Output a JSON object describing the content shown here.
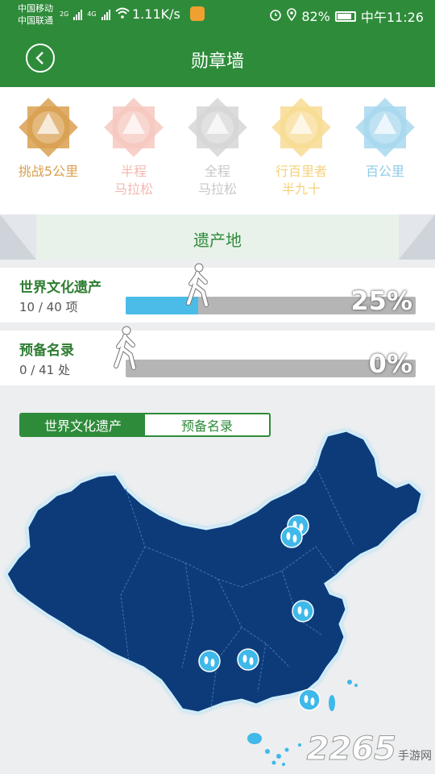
{
  "status_bar": {
    "carrier1": "中国移动",
    "carrier2": "中国联通",
    "net1": "2G",
    "net2": "4G",
    "speed": "1.11K/s",
    "battery": "82%",
    "time": "中午11:26"
  },
  "header": {
    "title": "勋章墙",
    "back_icon": "back-arrow-icon"
  },
  "badges": [
    {
      "label": "挑战5公里",
      "color": "#d9a050",
      "fill": "#d9a050",
      "state": "earned"
    },
    {
      "label": "半程\n马拉松",
      "color": "#f4b8b0",
      "fill": "#f6c8c0",
      "state": "locked"
    },
    {
      "label": "全程\n马拉松",
      "color": "#c8c8c8",
      "fill": "#d6d6d6",
      "state": "locked"
    },
    {
      "label": "行百里者\n半九十",
      "color": "#f5d27a",
      "fill": "#f8dc94",
      "state": "locked"
    },
    {
      "label": "百公里",
      "color": "#8fcbe8",
      "fill": "#a8d8ee",
      "state": "locked"
    }
  ],
  "section": {
    "title": "遗产地"
  },
  "progress": [
    {
      "name": "世界文化遗产",
      "count": "10 / 40 项",
      "percent_text": "25%",
      "fraction": 0.25
    },
    {
      "name": "预备名录",
      "count": "0 / 41 处",
      "percent_text": "0%",
      "fraction": 0.0
    }
  ],
  "tabs": {
    "active": "世界文化遗产",
    "inactive": "预备名录"
  },
  "map": {
    "land_color": "#0d3b7a",
    "marker_color": "#3fb8ea",
    "marker_icon": "footprints-icon"
  },
  "watermark": {
    "number": "2265",
    "site": "手游网"
  }
}
